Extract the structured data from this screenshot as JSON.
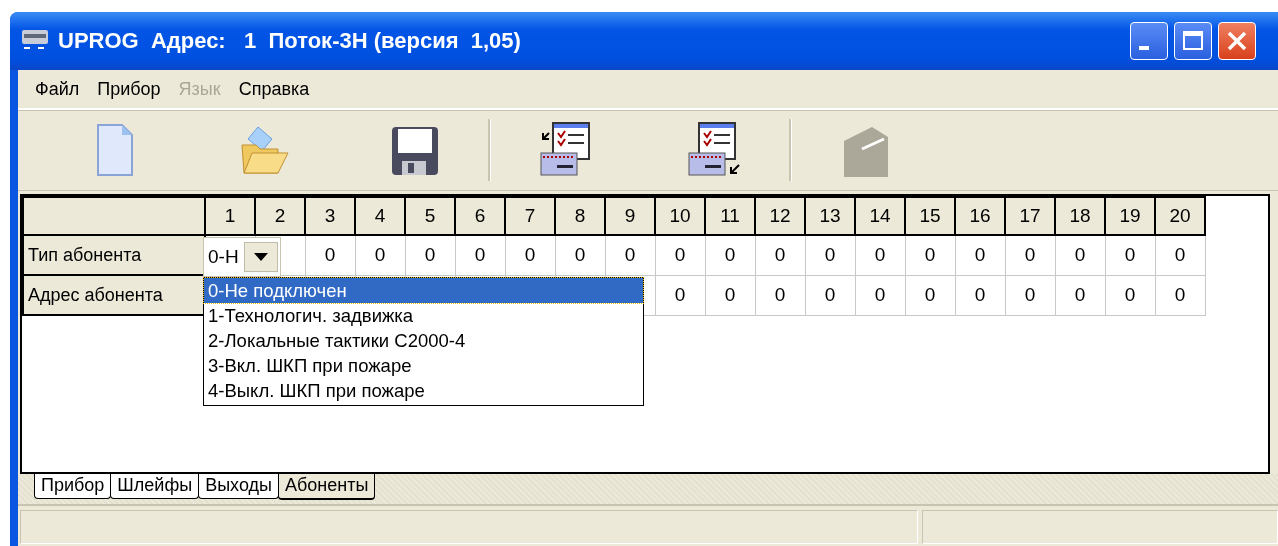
{
  "window": {
    "title": "UPROG  Адрес:   1  Поток-3Н (версия  1,05)"
  },
  "menu": [
    {
      "label": "Файл",
      "disabled": false
    },
    {
      "label": "Прибор",
      "disabled": false
    },
    {
      "label": "Язык",
      "disabled": true
    },
    {
      "label": "Справка",
      "disabled": false
    }
  ],
  "toolbar": {
    "groups": [
      [
        {
          "kind": "new",
          "disabled": false
        },
        {
          "kind": "open",
          "disabled": false
        },
        {
          "kind": "save",
          "disabled": false
        }
      ],
      [
        {
          "kind": "read",
          "disabled": false
        },
        {
          "kind": "write",
          "disabled": false
        }
      ],
      [
        {
          "kind": "device",
          "disabled": true
        }
      ]
    ]
  },
  "grid": {
    "columns": [
      "1",
      "2",
      "3",
      "4",
      "5",
      "6",
      "7",
      "8",
      "9",
      "10",
      "11",
      "12",
      "13",
      "14",
      "15",
      "16",
      "17",
      "18",
      "19",
      "20"
    ],
    "rows": [
      {
        "label": "Тип абонента",
        "cells": [
          null,
          null,
          "0",
          "0",
          "0",
          "0",
          "0",
          "0",
          "0",
          "0",
          "0",
          "0",
          "0",
          "0",
          "0",
          "0",
          "0",
          "0",
          "0",
          "0"
        ]
      },
      {
        "label": "Адрес абонента",
        "cells": [
          null,
          null,
          null,
          null,
          null,
          null,
          null,
          null,
          null,
          "0",
          "0",
          "0",
          "0",
          "0",
          "0",
          "0",
          "0",
          "0",
          "0",
          "0"
        ]
      }
    ],
    "editor": {
      "value": "0-Н",
      "options": [
        {
          "label": "0-Не подключен",
          "selected": true
        },
        {
          "label": "1-Технологич. задвижка",
          "selected": false
        },
        {
          "label": "2-Локальные тактики С2000-4",
          "selected": false
        },
        {
          "label": "3-Вкл. ШКП при пожаре",
          "selected": false
        },
        {
          "label": "4-Выкл. ШКП при пожаре",
          "selected": false
        }
      ]
    }
  },
  "tabs": [
    {
      "label": "Прибор",
      "selected": false
    },
    {
      "label": "Шлейфы",
      "selected": false
    },
    {
      "label": "Выходы",
      "selected": false
    },
    {
      "label": "Абоненты",
      "selected": true
    }
  ]
}
